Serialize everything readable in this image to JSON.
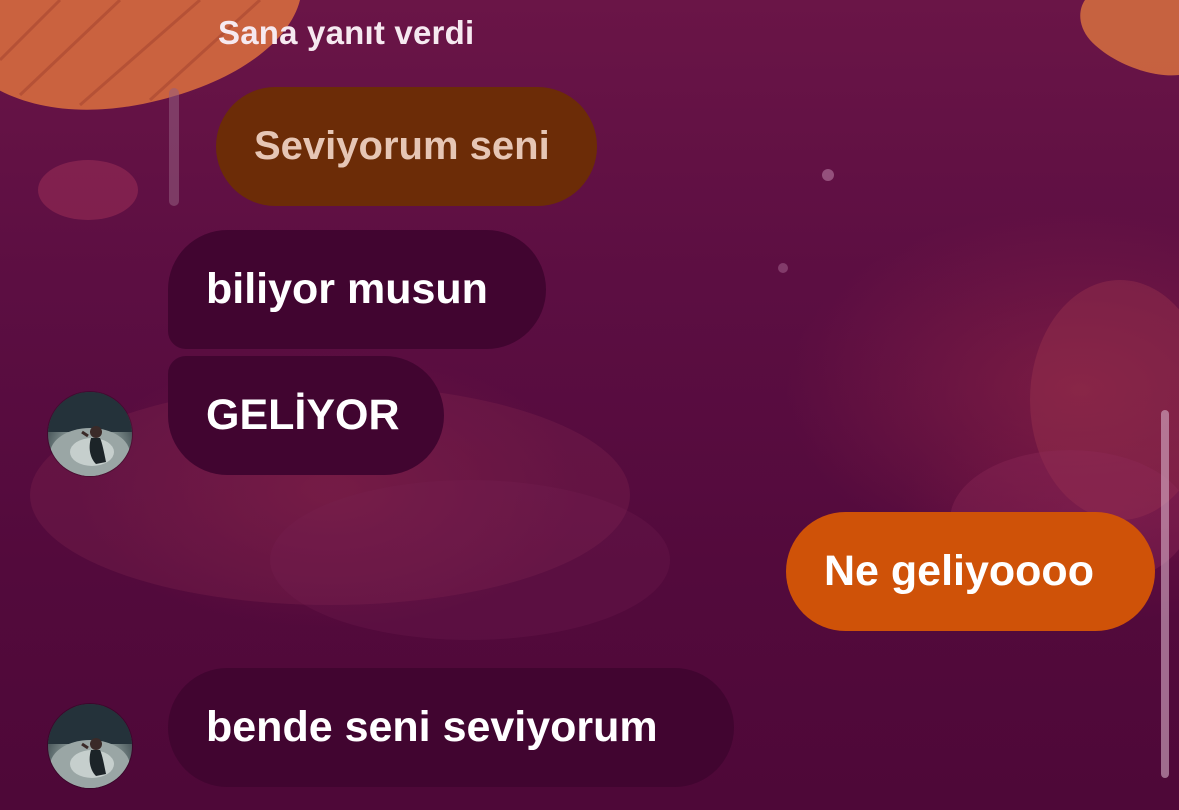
{
  "chat": {
    "reply_caption": "Sana yanıt verdi",
    "quoted_message": "Seviyorum seni",
    "messages": [
      {
        "text": "biliyor musun",
        "direction": "incoming"
      },
      {
        "text": "GELİYOR",
        "direction": "incoming"
      },
      {
        "text": "Ne geliyoooo",
        "direction": "outgoing"
      },
      {
        "text": "bende seni seviyorum",
        "direction": "incoming"
      }
    ]
  },
  "colors": {
    "background": "#5c0e42",
    "incoming_bubble": "#410530",
    "outgoing_bubble": "#cf5208",
    "quoted_bubble": "#6c2c07",
    "quoted_text": "#e6c6b5"
  },
  "icons": {
    "avatar": "profile-photo"
  }
}
